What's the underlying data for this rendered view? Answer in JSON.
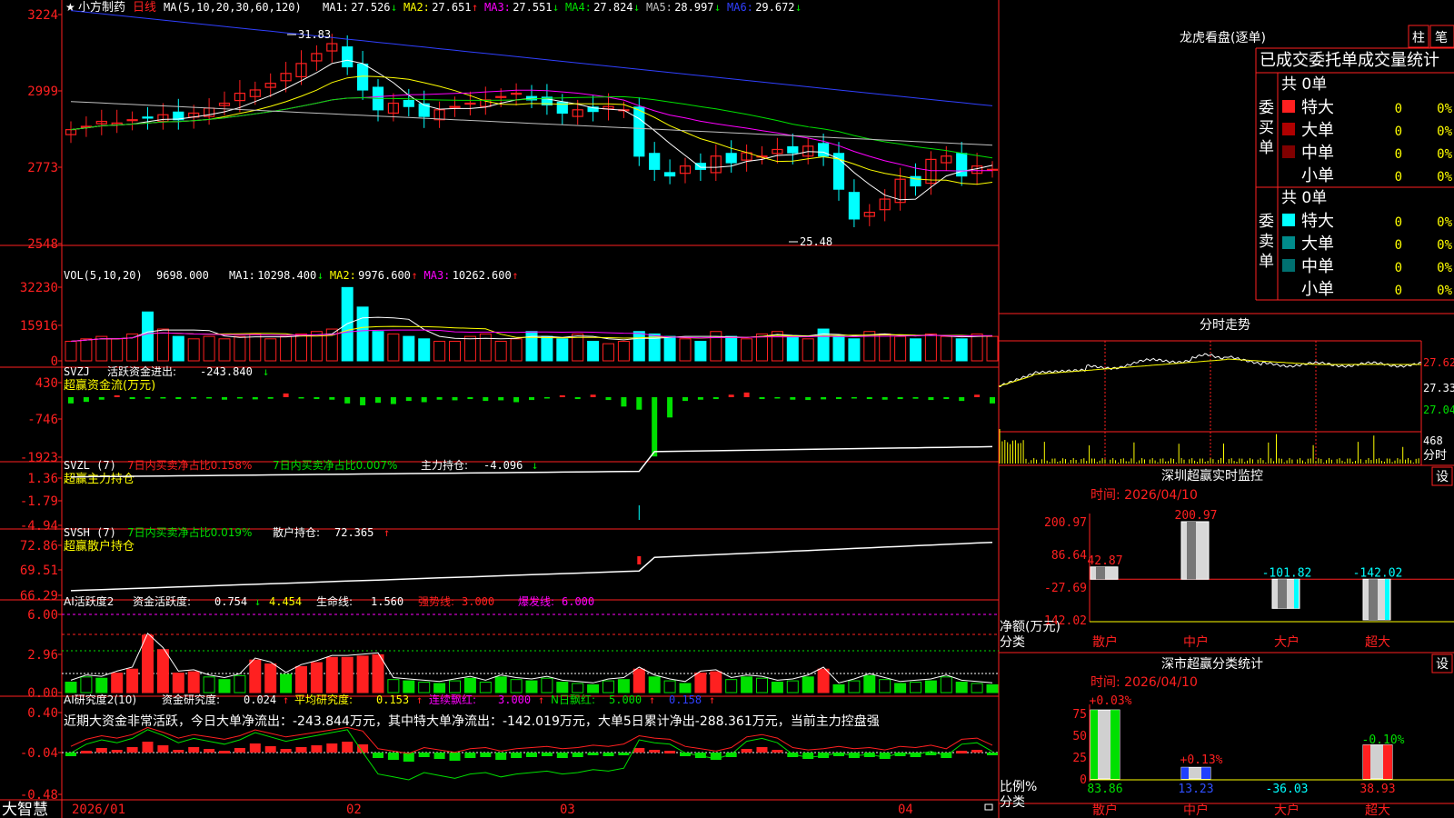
{
  "app": {
    "brand": "大智慧"
  },
  "colors": {
    "red": "#ff2020",
    "cyan": "#00ffff",
    "yellow": "#ffff00",
    "green": "#00e000",
    "magenta": "#ff00ff",
    "white": "#ffffff",
    "blue": "#3040ff",
    "gray": "#c0c0c0",
    "grid": "#8b0000",
    "axis": "#ff2020",
    "bg": "#000000",
    "label": "#ff3030"
  },
  "stock": {
    "name": "小方制药",
    "period": "日线"
  },
  "price_panel": {
    "ma_params": "MA(5,10,20,30,60,120)",
    "indicators": [
      {
        "label": "MA1:",
        "value": "27.526",
        "arrow": "↓",
        "color": "#ffffff"
      },
      {
        "label": "MA2:",
        "value": "27.651",
        "arrow": "↑",
        "color": "#ffff00"
      },
      {
        "label": "MA3:",
        "value": "27.551",
        "arrow": "↓",
        "color": "#ff00ff"
      },
      {
        "label": "MA4:",
        "value": "27.824",
        "arrow": "↓",
        "color": "#00e000"
      },
      {
        "label": "MA5:",
        "value": "28.997",
        "arrow": "↓",
        "color": "#c0c0c0"
      },
      {
        "label": "MA6:",
        "value": "29.672",
        "arrow": "↓",
        "color": "#3040ff"
      }
    ],
    "y_ticks": [
      "3224",
      "2999",
      "2773",
      "2548"
    ],
    "high_label": "31.83",
    "low_label": "25.48"
  },
  "vol_panel": {
    "header": "VOL(5,10,20)",
    "value": "9698.000",
    "indicators": [
      {
        "label": "MA1:",
        "value": "10298.400",
        "arrow": "↓",
        "color": "#ffffff"
      },
      {
        "label": "MA2:",
        "value": "9976.600",
        "arrow": "↑",
        "color": "#ffff00"
      },
      {
        "label": "MA3:",
        "value": "10262.600",
        "arrow": "↑",
        "color": "#ff00ff"
      }
    ],
    "y_ticks": [
      "32230",
      "15916",
      "0"
    ]
  },
  "svzj_panel": {
    "header": "SVZJ",
    "label": "活跃资金进出:",
    "value": "-243.840",
    "arrow": "↓",
    "sub": "超赢资金流(万元)",
    "y_ticks": [
      "430",
      "-746",
      "-1923"
    ]
  },
  "svzl_panel": {
    "header": "SVZL (7)",
    "t1": "7日内买卖净占比0.158%",
    "t2": "7日内买卖净占比0.007%",
    "t3": "主力持仓:",
    "value": "-4.096",
    "arrow": "↓",
    "sub": "超赢主力持仓",
    "y_ticks": [
      "1.36",
      "-1.79",
      "-4.94"
    ]
  },
  "svsh_panel": {
    "header": "SVSH (7)",
    "t1": "7日内买卖净占比0.019%",
    "t2": "散户持仓:",
    "value": "72.365",
    "arrow": "↑",
    "sub": "超赢散户持仓",
    "y_ticks": [
      "72.86",
      "69.51",
      "66.29"
    ]
  },
  "ai_act_panel": {
    "header": "AI活跃度2",
    "t1": "资金活跃度:",
    "v1": "0.754",
    "a1": "↓",
    "v2": "4.454",
    "t2": "生命线:",
    "v3": "1.560",
    "t3": "强势线:",
    "v4": "3.000",
    "t4": "爆发线:",
    "v5": "6.000",
    "y_ticks": [
      "6.00",
      "2.96",
      "0.00"
    ]
  },
  "ai_res_panel": {
    "header": "AI研究度2(10)",
    "t1": "资金研究度:",
    "v1": "0.024",
    "a1": "↑",
    "t2": "平均研究度:",
    "v2": "0.153",
    "a2": "↑",
    "t3": "连续飘红:",
    "v3": "3.000",
    "a3": "↑",
    "t4": "N日飘红:",
    "v4": "5.000",
    "a4": "↑",
    "v5": "0.158",
    "a5": "↑",
    "summary": "近期大资金非常活跃，今日大单净流出：-243.844万元，其中特大单净流出：-142.019万元，大单5日累计净出-288.361万元，当前主力控盘强",
    "y_ticks": [
      "0.40",
      "-0.04",
      "-0.48"
    ]
  },
  "x_axis": [
    "2026/01",
    "02",
    "03",
    "04"
  ],
  "dragon": {
    "title": "龙虎看盘(逐单)",
    "btn1": "柱",
    "btn2": "笔",
    "header": "已成交委托单成交量统计",
    "buy_side": "委买单",
    "sell_side": "委卖单",
    "buy_total": "共 0单",
    "sell_total": "共 0单",
    "buy_rows": [
      {
        "label": "特大",
        "count": "0",
        "pct": "0%"
      },
      {
        "label": "大单",
        "count": "0",
        "pct": "0%"
      },
      {
        "label": "中单",
        "count": "0",
        "pct": "0%"
      },
      {
        "label": "小单",
        "count": "0",
        "pct": "0%"
      }
    ],
    "sell_rows": [
      {
        "label": "特大",
        "count": "0",
        "pct": "0%"
      },
      {
        "label": "大单",
        "count": "0",
        "pct": "0%"
      },
      {
        "label": "中单",
        "count": "0",
        "pct": "0%"
      },
      {
        "label": "小单",
        "count": "0",
        "pct": "0%"
      }
    ]
  },
  "intraday": {
    "title": "分时走势",
    "y_ticks": [
      "27.62",
      "27.33",
      "27.04"
    ],
    "vol_tick": "468",
    "vol_unit": "分时"
  },
  "sz_monitor": {
    "title": "深圳超赢实时监控",
    "btn": "设",
    "time": "时间: 2026/04/10",
    "y_ticks": [
      "200.97",
      "86.64",
      "-27.69",
      "-142.02"
    ],
    "y_label_1": "净额(万元)",
    "y_label_2": "分类",
    "categories": [
      "散户",
      "中户",
      "大户",
      "超大"
    ]
  },
  "sz_stats": {
    "title": "深市超赢分类统计",
    "btn": "设",
    "time": "时间: 2026/04/10",
    "y_ticks": [
      "75",
      "50",
      "25",
      "0"
    ],
    "y_label_1": "比例%",
    "y_label_2": "分类",
    "categories": [
      "散户",
      "中户",
      "大户",
      "超大"
    ]
  },
  "chart_data": [
    {
      "type": "bar",
      "title": "深圳超赢实时监控",
      "categories": [
        "散户",
        "中户",
        "大户",
        "超大"
      ],
      "values": [
        42.87,
        200.97,
        -101.82,
        -142.02
      ],
      "ylabel": "净额(万元)",
      "ylim": [
        -142.02,
        200.97
      ]
    },
    {
      "type": "bar",
      "title": "深市超赢分类统计",
      "categories": [
        "散户",
        "中户",
        "大户",
        "超大"
      ],
      "series": [
        {
          "values": [
            83.86,
            13.23,
            -36.03,
            38.93
          ]
        },
        {
          "values": [
            0.03,
            0.13,
            null,
            -0.1
          ]
        }
      ],
      "ylabel": "比例%",
      "ylim": [
        0,
        75
      ]
    }
  ]
}
